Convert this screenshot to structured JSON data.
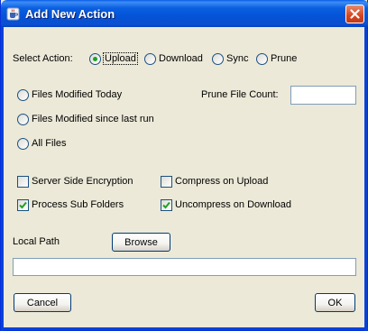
{
  "window": {
    "title": "Add New Action"
  },
  "action": {
    "label": "Select Action:",
    "options": [
      {
        "label": "Upload",
        "selected": true
      },
      {
        "label": "Download",
        "selected": false
      },
      {
        "label": "Sync",
        "selected": false
      },
      {
        "label": "Prune",
        "selected": false
      }
    ]
  },
  "files": {
    "options": [
      {
        "label": "Files Modified Today",
        "selected": false
      },
      {
        "label": "Files Modified since last run",
        "selected": false
      },
      {
        "label": "All Files",
        "selected": false
      }
    ],
    "prune_count_label": "Prune File Count:",
    "prune_count_value": ""
  },
  "options": {
    "server_side_encryption": {
      "label": "Server Side Encryption",
      "checked": false
    },
    "compress_on_upload": {
      "label": "Compress on Upload",
      "checked": false
    },
    "process_sub_folders": {
      "label": "Process Sub Folders",
      "checked": true
    },
    "uncompress_on_download": {
      "label": "Uncompress on Download",
      "checked": true
    }
  },
  "local_path": {
    "label": "Local Path",
    "browse_label": "Browse",
    "value": ""
  },
  "footer": {
    "cancel_label": "Cancel",
    "ok_label": "OK"
  },
  "colors": {
    "titlebar": "#0453d6",
    "dialog_bg": "#ece9d8",
    "close_button": "#d6451d",
    "radio_selected": "#21a121",
    "checkmark": "#21a121",
    "field_border": "#7f9db9"
  }
}
